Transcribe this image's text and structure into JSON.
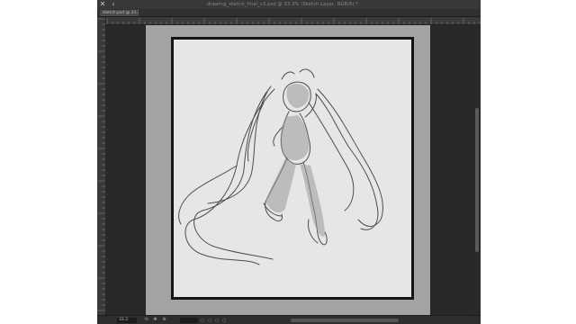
{
  "window": {
    "close_glyph": "✕",
    "menu_glyph": "‹",
    "title": "drawing_sketch_final_v3.psd @ 33.3% (Sketch Layer, RGB/8) *"
  },
  "tabs": [
    {
      "label": "sketch.psd @ 33.3%",
      "active": true
    }
  ],
  "status_bar": {
    "zoom": "33.3",
    "icons": [
      "rotate-icon",
      "pan-icon",
      "zoom-icon"
    ],
    "dots": "○ ○ ○ ○"
  },
  "canvas": {
    "artwork": "character sketch",
    "colors": {
      "pasteboard": "#282828",
      "canvas_bg": "#a3a3a3",
      "paper": "#e6e6e6",
      "frame": "#151515",
      "sketch_line": "#4e4e4e",
      "sketch_fill": "#9a9a9a"
    }
  }
}
